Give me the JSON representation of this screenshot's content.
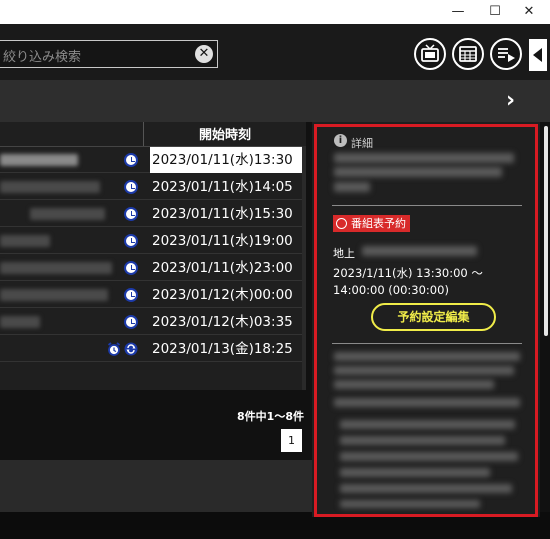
{
  "window": {
    "minimize_glyph": "—",
    "maximize_glyph": "☐",
    "close_glyph": "✕"
  },
  "toolbar": {
    "search_placeholder": "絞り込み検索",
    "clear_glyph": "✕",
    "icons": [
      "tv-icon",
      "program-guide-icon",
      "list-play-icon"
    ],
    "collapse_icon": "triangle-left-icon"
  },
  "subbar": {
    "next_glyph": "›"
  },
  "table": {
    "header_start_time": "開始時刻",
    "rows": [
      {
        "start_time": "2023/01/11(水)13:30",
        "selected": true
      },
      {
        "start_time": "2023/01/11(水)14:05",
        "selected": false
      },
      {
        "start_time": "2023/01/11(水)15:30",
        "selected": false
      },
      {
        "start_time": "2023/01/11(水)19:00",
        "selected": false
      },
      {
        "start_time": "2023/01/11(水)23:00",
        "selected": false
      },
      {
        "start_time": "2023/01/12(木)00:00",
        "selected": false
      },
      {
        "start_time": "2023/01/12(木)03:35",
        "selected": false
      },
      {
        "start_time": "2023/01/13(金)18:25",
        "selected": false
      }
    ],
    "count_text": "8件中1〜8件",
    "page": "1"
  },
  "detail": {
    "info_glyph": "i",
    "label": "詳細",
    "badge": "番組表予約",
    "channel_label": "地上",
    "time_line1": "2023/1/11(水) 13:30:00 〜",
    "time_line2": "14:00:00 (00:30:00)",
    "edit_button": "予約設定編集"
  },
  "colors": {
    "highlight_border": "#d81b23",
    "edit_button": "#f0ec49",
    "clock_icon": "#1c3aa9"
  }
}
